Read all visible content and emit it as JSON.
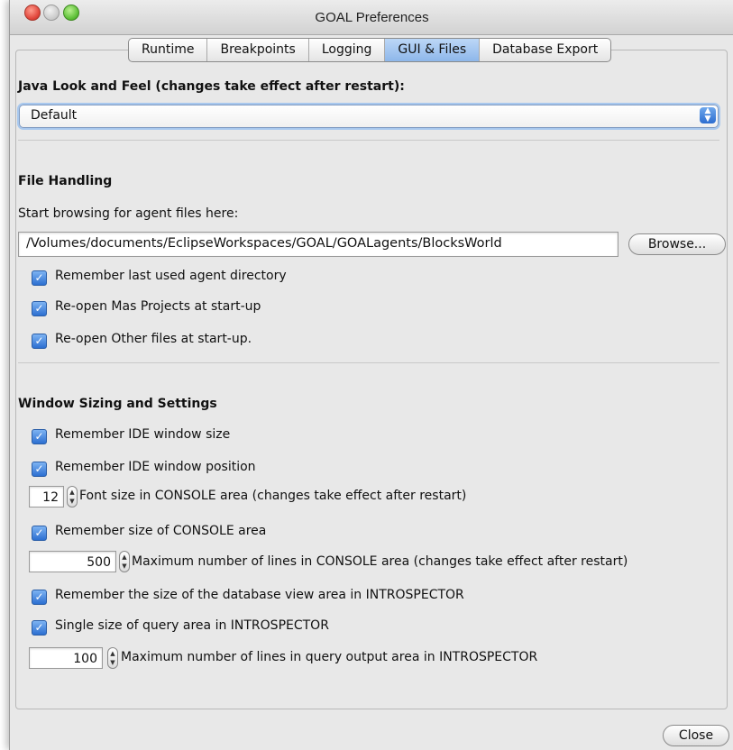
{
  "window": {
    "title": "GOAL Preferences"
  },
  "tabs": [
    {
      "label": "Runtime",
      "active": false
    },
    {
      "label": "Breakpoints",
      "active": false
    },
    {
      "label": "Logging",
      "active": false
    },
    {
      "label": "GUI & Files",
      "active": true
    },
    {
      "label": "Database Export",
      "active": false
    }
  ],
  "look_and_feel": {
    "heading": "Java Look and Feel (changes take effect after restart):",
    "selected": "Default"
  },
  "file_handling": {
    "heading": "File Handling",
    "browse_label": "Start browsing for agent files here:",
    "path_value": "/Volumes/documents/EclipseWorkspaces/GOAL/GOALagents/BlocksWorld",
    "browse_button": "Browse...",
    "checkboxes": [
      {
        "label": "Remember last used agent directory",
        "checked": true
      },
      {
        "label": "Re-open Mas Projects at start-up",
        "checked": true
      },
      {
        "label": "Re-open Other files at start-up.",
        "checked": true
      }
    ]
  },
  "window_sizing": {
    "heading": "Window Sizing and Settings",
    "remember_size": {
      "label": "Remember IDE window size",
      "checked": true
    },
    "remember_position": {
      "label": "Remember IDE window position",
      "checked": true
    },
    "font_size": {
      "value": "12",
      "label": "Font size in CONSOLE area (changes take effect after restart)"
    },
    "remember_console": {
      "label": "Remember size of CONSOLE area",
      "checked": true
    },
    "max_lines_console": {
      "value": "500",
      "label": "Maximum number of lines in CONSOLE area (changes take effect after restart)"
    },
    "remember_db_view": {
      "label": "Remember the size of the database view area in INTROSPECTOR",
      "checked": true
    },
    "single_query": {
      "label": "Single size of query area in INTROSPECTOR",
      "checked": true
    },
    "max_lines_query": {
      "value": "100",
      "label": "Maximum number of lines in query output area in INTROSPECTOR"
    }
  },
  "footer": {
    "close_button": "Close"
  },
  "icons": {
    "checkbox": "checkmark-icon",
    "select_arrow": "updown-arrows-icon",
    "stepper": "stepper-arrows-icon"
  }
}
